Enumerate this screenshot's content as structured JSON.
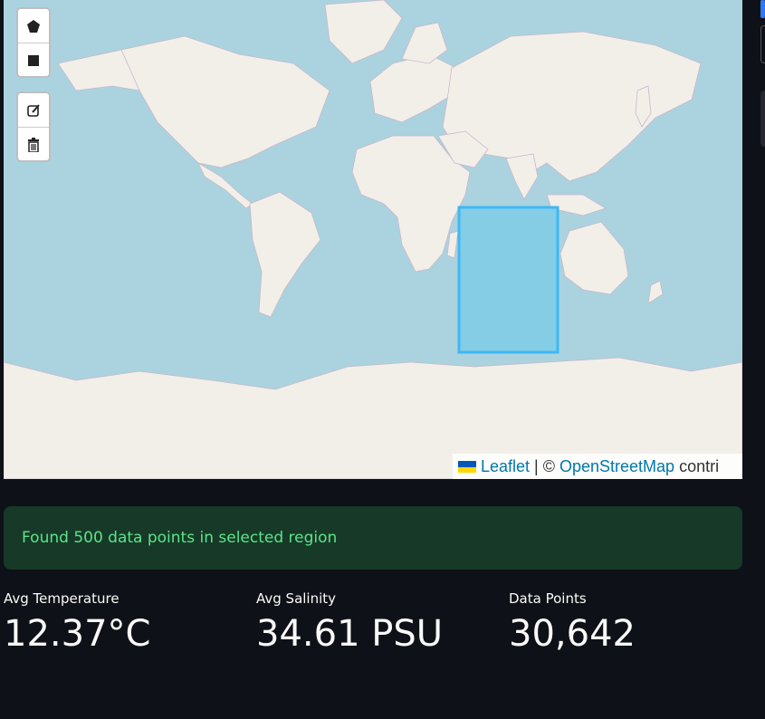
{
  "map": {
    "toolbar": {
      "draw": [
        {
          "name": "draw-polygon-button",
          "icon": "pentagon-icon"
        },
        {
          "name": "draw-rectangle-button",
          "icon": "square-icon"
        }
      ],
      "edit": [
        {
          "name": "edit-layers-button",
          "icon": "edit-icon"
        },
        {
          "name": "delete-layers-button",
          "icon": "trash-icon"
        }
      ]
    },
    "attribution": {
      "leaflet": "Leaflet",
      "separator": "| ©",
      "osm": "OpenStreetMap",
      "trailing": "contri"
    },
    "colors": {
      "water": "#aad3df",
      "land": "#f2efe9",
      "selection_fill": "#7fcbe6",
      "selection_stroke": "#3db8f5"
    }
  },
  "status": {
    "message": "Found 500 data points in selected region"
  },
  "metrics": [
    {
      "label": "Avg Temperature",
      "value": "12.37°C"
    },
    {
      "label": "Avg Salinity",
      "value": "34.61 PSU"
    },
    {
      "label": "Data Points",
      "value": "30,642"
    }
  ]
}
